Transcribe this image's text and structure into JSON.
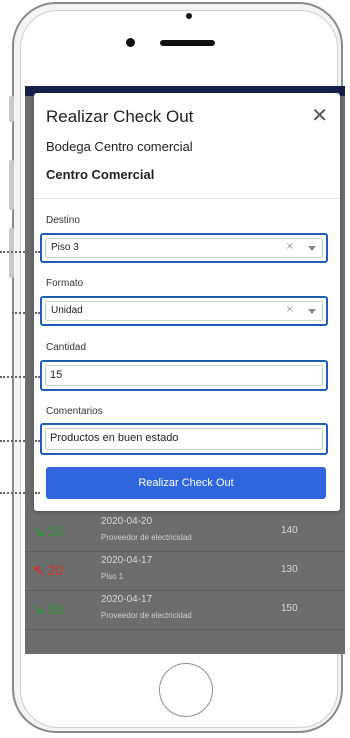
{
  "modal": {
    "title": "Realizar Check Out",
    "subtitle": "Bodega Centro comercial",
    "location": "Centro Comercial",
    "fields": {
      "destino": {
        "label": "Destino",
        "value": "Piso 3",
        "clear": "×"
      },
      "formato": {
        "label": "Formato",
        "value": "Unidad",
        "clear": "×"
      },
      "cantidad": {
        "label": "Cantidad",
        "value": "15"
      },
      "comentarios": {
        "label": "Comentarios",
        "value": "Productos en buen estado"
      }
    },
    "submit_label": "Realizar Check Out",
    "close_glyph": "✕"
  },
  "background_list": [
    {
      "arrow": "↘",
      "qty": "10",
      "date": "2020-04-20",
      "source": "Proveedor de electricidad",
      "value": "140",
      "color": "#2e9a3f"
    },
    {
      "arrow": "↖",
      "qty": "20",
      "date": "2020-04-17",
      "source": "Piso 1",
      "value": "130",
      "color": "#d0312d"
    },
    {
      "arrow": "↘",
      "qty": "50",
      "date": "2020-04-17",
      "source": "Proveedor de electricidad",
      "value": "150",
      "color": "#2e9a3f"
    }
  ],
  "colors": {
    "accent": "#2f66dd",
    "highlight_border": "#1f5fb8",
    "app_bar": "#15214a"
  }
}
